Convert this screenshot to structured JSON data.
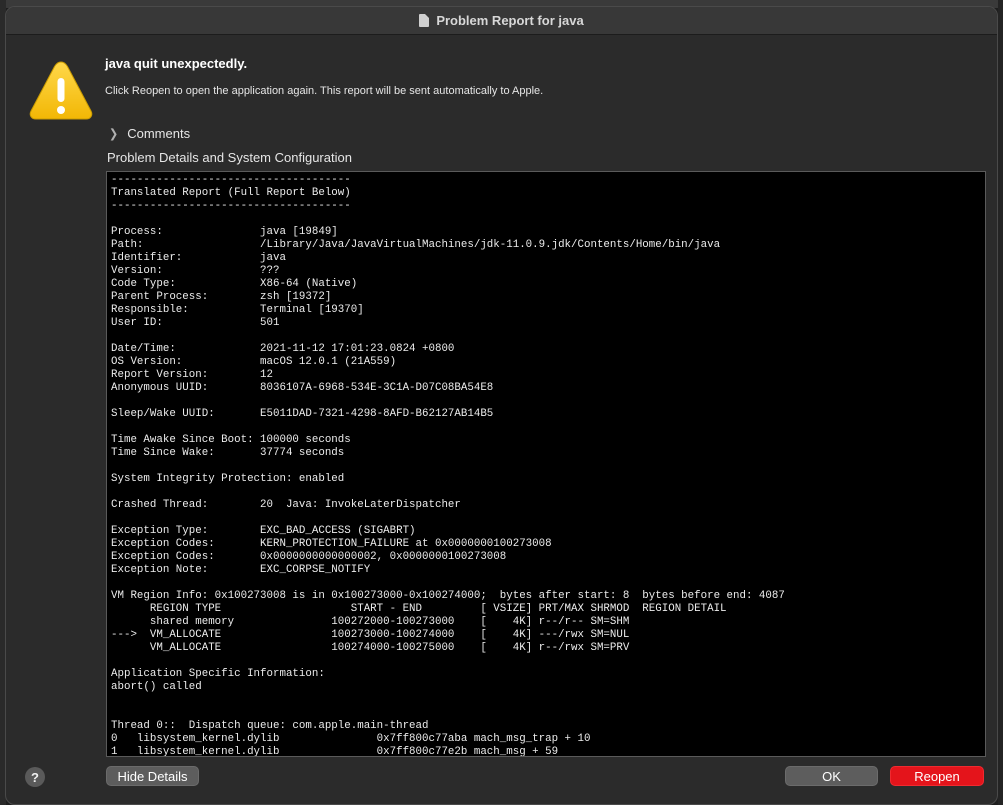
{
  "window": {
    "title": "Problem Report for java"
  },
  "alert": {
    "headline": "java quit unexpectedly.",
    "message": "Click Reopen to open the application again. This report will be sent automatically to Apple."
  },
  "comments": {
    "label": "Comments"
  },
  "details": {
    "label": "Problem Details and System Configuration",
    "report_text": "-------------------------------------\nTranslated Report (Full Report Below)\n-------------------------------------\n\nProcess:               java [19849]\nPath:                  /Library/Java/JavaVirtualMachines/jdk-11.0.9.jdk/Contents/Home/bin/java\nIdentifier:            java\nVersion:               ???\nCode Type:             X86-64 (Native)\nParent Process:        zsh [19372]\nResponsible:           Terminal [19370]\nUser ID:               501\n\nDate/Time:             2021-11-12 17:01:23.0824 +0800\nOS Version:            macOS 12.0.1 (21A559)\nReport Version:        12\nAnonymous UUID:        8036107A-6968-534E-3C1A-D07C08BA54E8\n\nSleep/Wake UUID:       E5011DAD-7321-4298-8AFD-B62127AB14B5\n\nTime Awake Since Boot: 100000 seconds\nTime Since Wake:       37774 seconds\n\nSystem Integrity Protection: enabled\n\nCrashed Thread:        20  Java: InvokeLaterDispatcher\n\nException Type:        EXC_BAD_ACCESS (SIGABRT)\nException Codes:       KERN_PROTECTION_FAILURE at 0x0000000100273008\nException Codes:       0x0000000000000002, 0x0000000100273008\nException Note:        EXC_CORPSE_NOTIFY\n\nVM Region Info: 0x100273008 is in 0x100273000-0x100274000;  bytes after start: 8  bytes before end: 4087\n      REGION TYPE                    START - END         [ VSIZE] PRT/MAX SHRMOD  REGION DETAIL\n      shared memory               100272000-100273000    [    4K] r--/r-- SM=SHM\n--->  VM_ALLOCATE                 100273000-100274000    [    4K] ---/rwx SM=NUL\n      VM_ALLOCATE                 100274000-100275000    [    4K] r--/rwx SM=PRV\n\nApplication Specific Information:\nabort() called\n\n\nThread 0::  Dispatch queue: com.apple.main-thread\n0   libsystem_kernel.dylib               0x7ff800c77aba mach_msg_trap + 10\n1   libsystem_kernel.dylib               0x7ff800c77e2b mach_msg + 59"
  },
  "buttons": {
    "help": "?",
    "hide_details": "Hide Details",
    "ok": "OK",
    "reopen": "Reopen"
  },
  "icons": {
    "title_icon": "document-icon",
    "alert_icon": "warning-triangle-icon",
    "comments_toggle": "chevron-right-icon"
  },
  "colors": {
    "primary_button": "#e4141b",
    "warning_yellow": "#f5c518"
  }
}
